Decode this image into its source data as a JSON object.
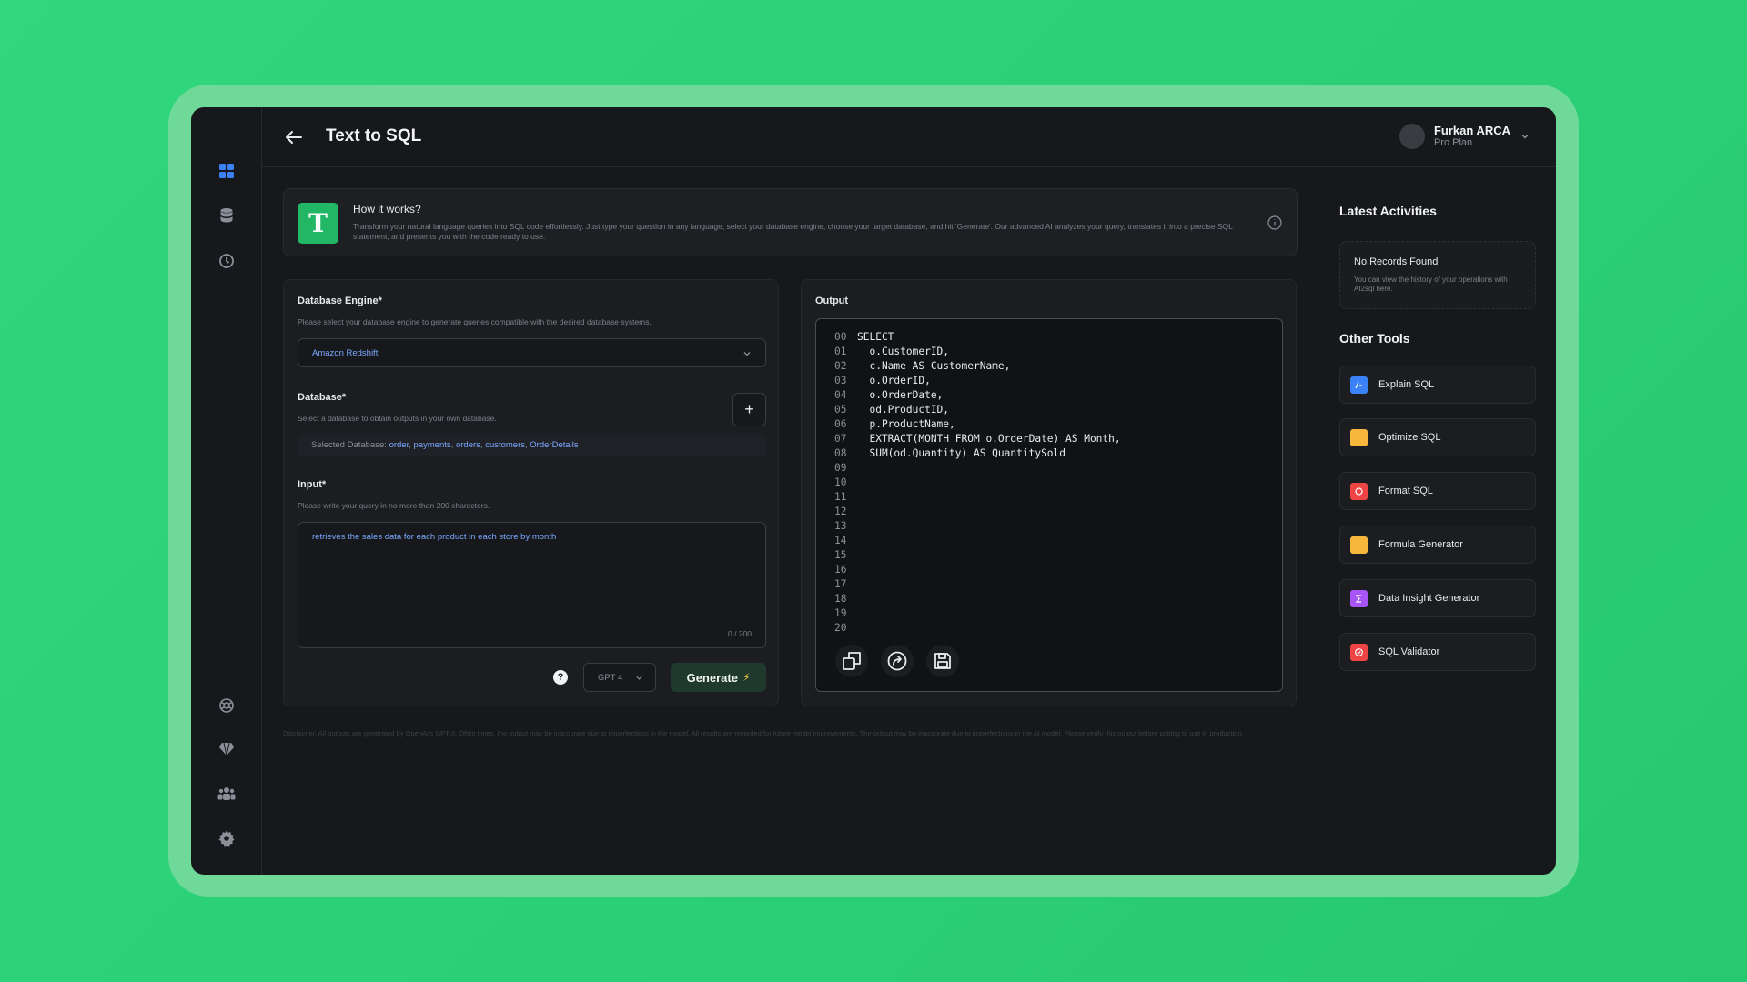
{
  "header": {
    "title": "Text to SQL",
    "user_name": "Furkan ARCA",
    "user_plan": "Pro Plan"
  },
  "sidebar": {
    "top_icons": [
      "dashboard-icon",
      "database-icon",
      "history-icon"
    ],
    "bottom_icons": [
      "globe-icon",
      "diamond-icon",
      "team-icon",
      "gear-icon"
    ]
  },
  "how_it_works": {
    "title": "How it works?",
    "text": "Transform your natural language queries into SQL code effortlessly. Just type your question in any language, select your database engine, choose your target database, and hit 'Generate'. Our advanced AI analyzes your query, translates it into a precise SQL statement, and presents you with the code ready to use.",
    "logo_letter": "T"
  },
  "form": {
    "engine_label": "Database Engine*",
    "engine_hint": "Please select your database engine to generate queries compatible with the desired database systems.",
    "engine_value": "Amazon Redshift",
    "database_label": "Database*",
    "database_hint": "Select a database to obtain outputs in your own database.",
    "add_label": "+",
    "selected_prefix": "Selected Database:",
    "selected_databases": [
      "order",
      "payments",
      "orders",
      "customers",
      "OrderDetails"
    ],
    "input_label": "Input*",
    "input_hint": "Please write your query in no more than 200 characters.",
    "input_value": "retrieves the sales data for each product in each store by month",
    "input_count": "0 / 200",
    "help_label": "?",
    "model_value": "GPT 4",
    "generate_label": "Generate",
    "generate_bolt": "⚡"
  },
  "output": {
    "label": "Output",
    "lines": [
      {
        "n": "00",
        "code": "SELECT"
      },
      {
        "n": "01",
        "code": "  o.CustomerID,"
      },
      {
        "n": "02",
        "code": "  c.Name AS CustomerName,"
      },
      {
        "n": "03",
        "code": "  o.OrderID,"
      },
      {
        "n": "04",
        "code": "  o.OrderDate,"
      },
      {
        "n": "05",
        "code": "  od.ProductID,"
      },
      {
        "n": "06",
        "code": "  p.ProductName,"
      },
      {
        "n": "07",
        "code": "  EXTRACT(MONTH FROM o.OrderDate) AS Month,"
      },
      {
        "n": "08",
        "code": "  SUM(od.Quantity) AS QuantitySold"
      },
      {
        "n": "09",
        "code": ""
      },
      {
        "n": "10",
        "code": ""
      },
      {
        "n": "11",
        "code": ""
      },
      {
        "n": "12",
        "code": ""
      },
      {
        "n": "13",
        "code": ""
      },
      {
        "n": "14",
        "code": ""
      },
      {
        "n": "15",
        "code": ""
      },
      {
        "n": "16",
        "code": ""
      },
      {
        "n": "17",
        "code": ""
      },
      {
        "n": "18",
        "code": ""
      },
      {
        "n": "19",
        "code": ""
      },
      {
        "n": "20",
        "code": ""
      }
    ],
    "actions": [
      "copy-icon",
      "share-icon",
      "save-icon"
    ]
  },
  "disclaimer": "Disclaimer: All outputs are generated by OpenAI's GPT-3. Often times, the output may be inaccurate due to imperfections in the model. All results are recorded for future model improvements. The output may be inaccurate due to imperfections in the AI model. Please verify this output before putting to use in production.",
  "right": {
    "activities_title": "Latest Activities",
    "no_records_title": "No Records Found",
    "no_records_text": "You can view the history of your operations with AI2sql here.",
    "tools_title": "Other Tools",
    "tools": [
      {
        "label": "Explain SQL",
        "color": "#3b82f6",
        "icon": "explain-icon"
      },
      {
        "label": "Optimize SQL",
        "color": "#f6b73c",
        "icon": "optimize-icon"
      },
      {
        "label": "Format SQL",
        "color": "#ef4444",
        "icon": "format-icon"
      },
      {
        "label": "Formula Generator",
        "color": "#f6b73c",
        "icon": "formula-icon"
      },
      {
        "label": "Data Insight Generator",
        "color": "#a855f7",
        "icon": "insight-icon"
      },
      {
        "label": "SQL Validator",
        "color": "#ef4444",
        "icon": "validator-icon"
      }
    ]
  }
}
